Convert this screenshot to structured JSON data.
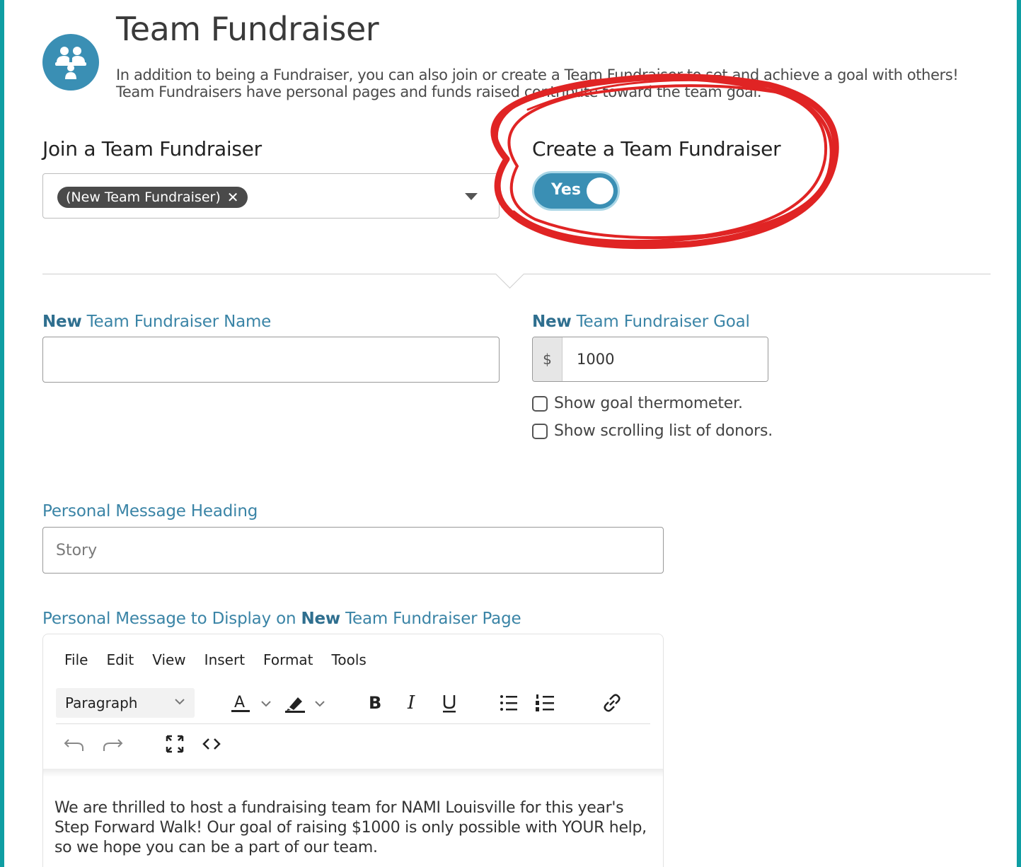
{
  "header": {
    "title": "Team Fundraiser",
    "description": "In addition to being a Fundraiser, you can also join or create a Team Fundraiser to set and achieve a goal with others! Team Fundraisers have personal pages and funds raised contribute toward the team goal."
  },
  "join": {
    "heading": "Join a Team Fundraiser",
    "selected_chip": "(New Team Fundraiser)"
  },
  "create": {
    "heading": "Create a Team Fundraiser",
    "toggle_label": "Yes",
    "toggle_on": true
  },
  "name_field": {
    "label_bold": "New",
    "label_rest": " Team Fundraiser Name",
    "value": ""
  },
  "goal_field": {
    "label_bold": "New",
    "label_rest": " Team Fundraiser Goal",
    "prefix": "$",
    "value": "1000"
  },
  "checkboxes": [
    {
      "label": "Show goal thermometer.",
      "checked": false
    },
    {
      "label": "Show scrolling list of donors.",
      "checked": false
    }
  ],
  "heading_field": {
    "label": "Personal Message Heading",
    "placeholder": "Story"
  },
  "message_field": {
    "label_start": "Personal Message to Display on ",
    "label_bold": "New",
    "label_end": " Team Fundraiser Page"
  },
  "editor": {
    "menu": [
      "File",
      "Edit",
      "View",
      "Insert",
      "Format",
      "Tools"
    ],
    "block_format": "Paragraph",
    "toolbar_icons": [
      "text-color-icon",
      "highlight-icon",
      "bold-icon",
      "italic-icon",
      "underline-icon",
      "bullet-list-icon",
      "numbered-list-icon",
      "link-icon",
      "undo-icon",
      "redo-icon",
      "fullscreen-icon",
      "code-icon"
    ],
    "body": "We are thrilled to host a fundraising team for NAMI Louisville for this year's Step Forward Walk! Our goal of raising $1000 is only possible with YOUR help, so we hope you can be a part of our team."
  },
  "colors": {
    "frame": "#0f9ea3",
    "accent": "#3a8fb4",
    "label": "#3a84a6",
    "annotation": "#e02424"
  }
}
